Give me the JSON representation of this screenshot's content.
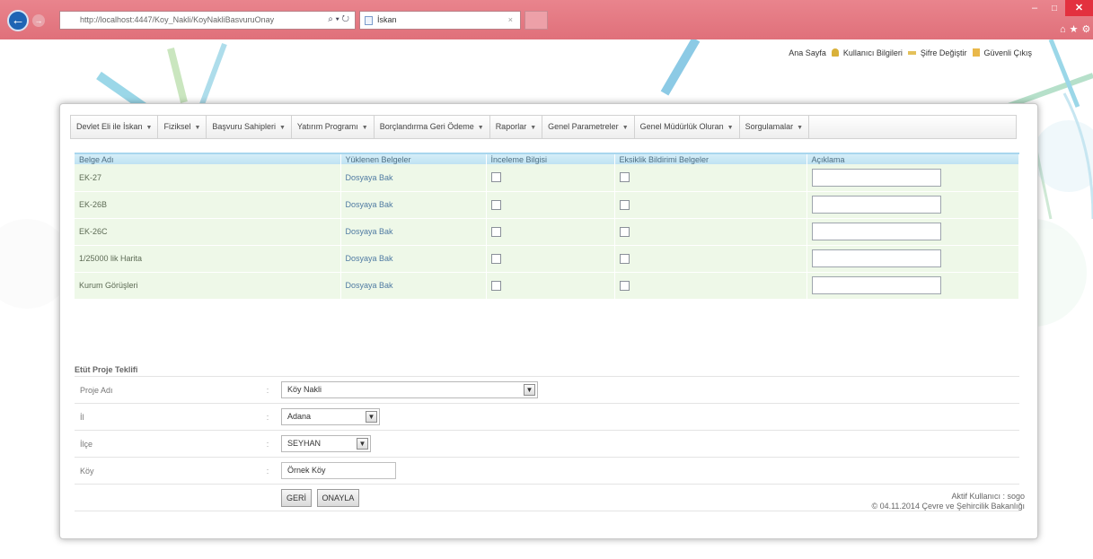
{
  "browser": {
    "address": "http://localhost:4447/Koy_Nakli/KoyNakliBasvuruOnay",
    "address_host": "localhost",
    "tab_title": "İskan",
    "win_min": "–",
    "win_max": "□",
    "win_close": "✕"
  },
  "header": {
    "links": [
      "Ana Sayfa",
      "Kullanıcı Bilgileri",
      "Şifre Değiştir",
      "Güvenli Çıkış"
    ]
  },
  "menu": [
    "Devlet Eli ile İskan",
    "Fiziksel",
    "Başvuru Sahipleri",
    "Yatırım Programı",
    "Borçlandırma Geri Ödeme",
    "Raporlar",
    "Genel Parametreler",
    "Genel Müdürlük Oluran",
    "Sorgulamalar"
  ],
  "documents": {
    "headers": [
      "Belge Adı",
      "Yüklenen Belgeler",
      "İnceleme Bilgisi",
      "Eksiklik Bildirimi Belgeler",
      "Açıklama"
    ],
    "rows": [
      {
        "name": "EK-27",
        "link": "Dosyaya Bak"
      },
      {
        "name": "EK-26B",
        "link": "Dosyaya Bak"
      },
      {
        "name": "EK-26C",
        "link": "Dosyaya Bak"
      },
      {
        "name": "1/25000 lik Harita",
        "link": "Dosyaya Bak"
      },
      {
        "name": "Kurum Görüşleri",
        "link": "Dosyaya Bak"
      }
    ]
  },
  "form": {
    "title": "Etüt Proje Teklifi",
    "separator": ":",
    "fields": {
      "project_label": "Proje Adı",
      "project_value": "Köy Nakli",
      "il_label": "İl",
      "il_value": "Adana",
      "ilce_label": "İlçe",
      "ilce_value": "SEYHAN",
      "koy_label": "Köy",
      "koy_value": "Örnek Köy"
    },
    "back_button": "GERİ",
    "approve_button": "ONAYLA"
  },
  "footer": {
    "user_line": "Aktif Kullanıcı : sogo",
    "copyright": "© 04.11.2014 Çevre ve Şehircilik Bakanlığı"
  }
}
